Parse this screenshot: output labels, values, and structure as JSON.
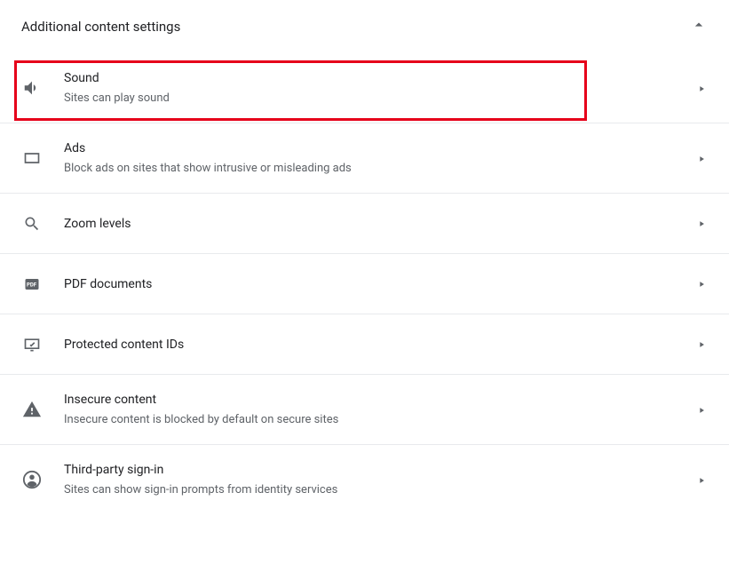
{
  "header": {
    "title": "Additional content settings"
  },
  "items": [
    {
      "icon": "sound-icon",
      "label": "Sound",
      "sub": "Sites can play sound",
      "highlighted": true
    },
    {
      "icon": "ads-icon",
      "label": "Ads",
      "sub": "Block ads on sites that show intrusive or misleading ads"
    },
    {
      "icon": "zoom-icon",
      "label": "Zoom levels",
      "sub": ""
    },
    {
      "icon": "pdf-icon",
      "label": "PDF documents",
      "sub": ""
    },
    {
      "icon": "protected-icon",
      "label": "Protected content IDs",
      "sub": ""
    },
    {
      "icon": "insecure-icon",
      "label": "Insecure content",
      "sub": "Insecure content is blocked by default on secure sites"
    },
    {
      "icon": "signin-icon",
      "label": "Third-party sign-in",
      "sub": "Sites can show sign-in prompts from identity services"
    }
  ]
}
